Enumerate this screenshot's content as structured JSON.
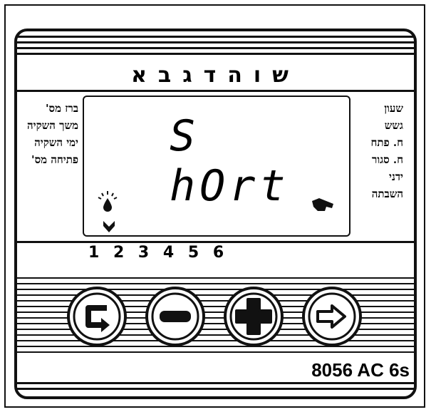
{
  "device": {
    "title": "שוהדגבא",
    "display_text": "S hOrt",
    "left_labels": [
      "ברז מס'",
      "משך השקיה",
      "ימי השקיה",
      "פתיחה מס'"
    ],
    "right_labels": [
      "שעון",
      "גשש",
      "ח. פתח",
      "ח. סגור",
      "ידני",
      "השבתה"
    ],
    "station_numbers": "1 2 3 4 5 6",
    "model": "8056 AC 6s"
  },
  "icons": {
    "drop": "water-drop-icon",
    "hand": "manual-hand-icon",
    "pointer": "station-pointer-arrow-icon",
    "cycle": "cycle-button-icon",
    "minus": "minus-button-icon",
    "plus": "plus-button-icon",
    "next": "next-arrow-button-icon"
  }
}
